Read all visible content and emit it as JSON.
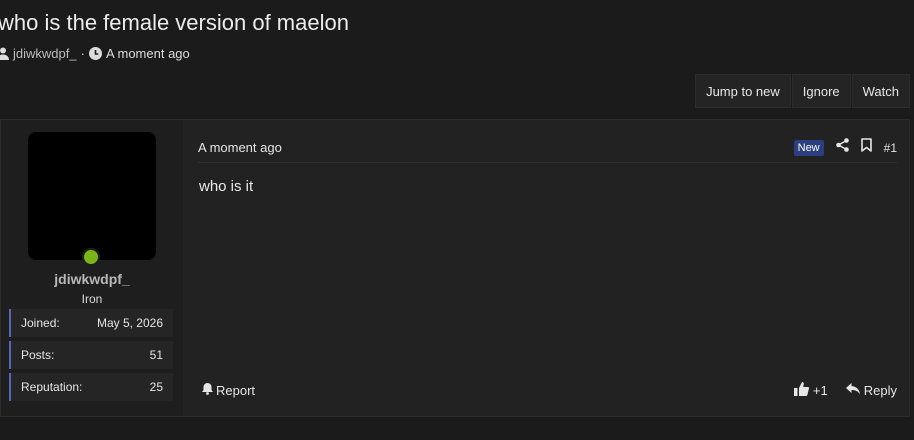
{
  "thread": {
    "title": "who is the female version of maelon",
    "author": "jdiwkwdpf_",
    "separator": "·",
    "posted": "A moment ago"
  },
  "actions": {
    "jump_label": "Jump to new",
    "ignore_label": "Ignore",
    "watch_label": "Watch"
  },
  "post": {
    "user": {
      "name": "jdiwkwdpf_",
      "rank": "Iron",
      "online_color": "#7cb518",
      "stats": [
        {
          "label": "Joined:",
          "value": "May 5, 2026"
        },
        {
          "label": "Posts:",
          "value": "51"
        },
        {
          "label": "Reputation:",
          "value": "25"
        }
      ]
    },
    "time": "A moment ago",
    "badge": "New",
    "number": "#1",
    "body": "who is it",
    "report_label": "Report",
    "like_count": "+1",
    "reply_label": "Reply"
  },
  "icons": {
    "author": "user-icon",
    "time": "clock-icon",
    "share": "share-icon",
    "bookmark": "bookmark-icon",
    "report": "bell-icon",
    "like": "thumbs-up-icon",
    "reply": "reply-icon"
  },
  "colors": {
    "background": "#1b1b1b",
    "panel": "#222222",
    "accent": "#5a67b8",
    "badge": "#2b3f7e"
  }
}
